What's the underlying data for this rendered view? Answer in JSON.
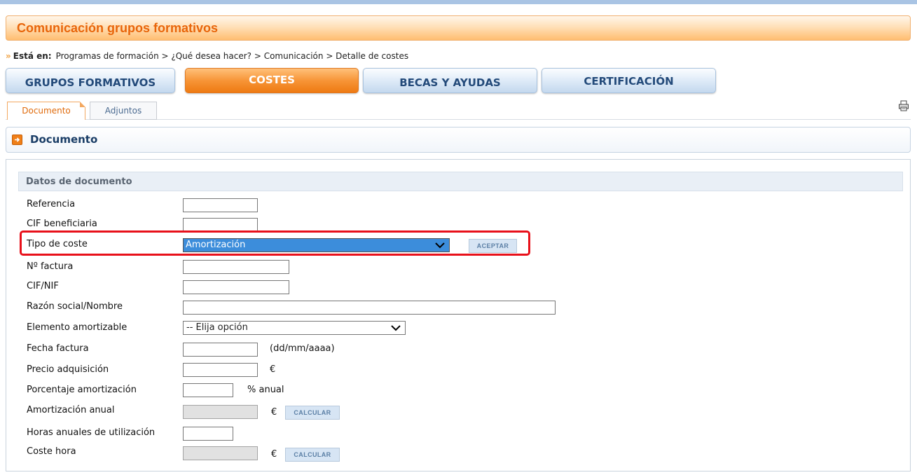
{
  "app_title": "Comunicación grupos formativos",
  "breadcrumb": {
    "lead": "Está en:",
    "path": "Programas de formación > ¿Qué desea hacer? > Comunicación > Detalle de costes"
  },
  "main_tabs": [
    {
      "label": "GRUPOS FORMATIVOS",
      "active": false
    },
    {
      "label": "COSTES",
      "active": true
    },
    {
      "label": "BECAS Y AYUDAS",
      "active": false
    },
    {
      "label": "CERTIFICACIÓN",
      "active": false
    }
  ],
  "sub_tabs": [
    {
      "label": "Documento",
      "active": true
    },
    {
      "label": "Adjuntos",
      "active": false
    }
  ],
  "panel": {
    "title": "Documento"
  },
  "form": {
    "section_title": "Datos de documento",
    "referencia": {
      "label": "Referencia",
      "value": ""
    },
    "cif_beneficiaria": {
      "label": "CIF beneficiaria",
      "value": ""
    },
    "tipo_coste": {
      "label": "Tipo de coste",
      "selected": "Amortización",
      "button": "ACEPTAR"
    },
    "n_factura": {
      "label": "Nº factura",
      "value": ""
    },
    "cif_nif": {
      "label": "CIF/NIF",
      "value": ""
    },
    "razon_social": {
      "label": "Razón social/Nombre",
      "value": ""
    },
    "elemento_amortizable": {
      "label": "Elemento amortizable",
      "selected": "-- Elija opción"
    },
    "fecha_factura": {
      "label": "Fecha factura",
      "value": "",
      "hint": "(dd/mm/aaaa)"
    },
    "precio_adquisicion": {
      "label": "Precio adquisición",
      "value": "",
      "unit": "€"
    },
    "porcentaje_amortizacion": {
      "label": "Porcentaje amortización",
      "value": "",
      "unit": "% anual"
    },
    "amortizacion_anual": {
      "label": "Amortización anual",
      "value": "",
      "unit": "€",
      "button": "CALCULAR"
    },
    "horas_anuales": {
      "label": "Horas anuales de utilización",
      "value": ""
    },
    "coste_hora": {
      "label": "Coste hora",
      "value": "",
      "unit": "€",
      "button": "CALCULAR"
    }
  },
  "icons": {
    "breadcrumb_marker": "double-chevron-right-icon",
    "panel_icon": "arrow-right-box-icon",
    "print": "printer-icon",
    "select_arrow": "chevron-down-icon"
  },
  "colors": {
    "accent_orange": "#f07f18",
    "tab_blue": "#234a7a",
    "highlight_red": "#e8101a",
    "select_highlight": "#3c8ddb"
  }
}
